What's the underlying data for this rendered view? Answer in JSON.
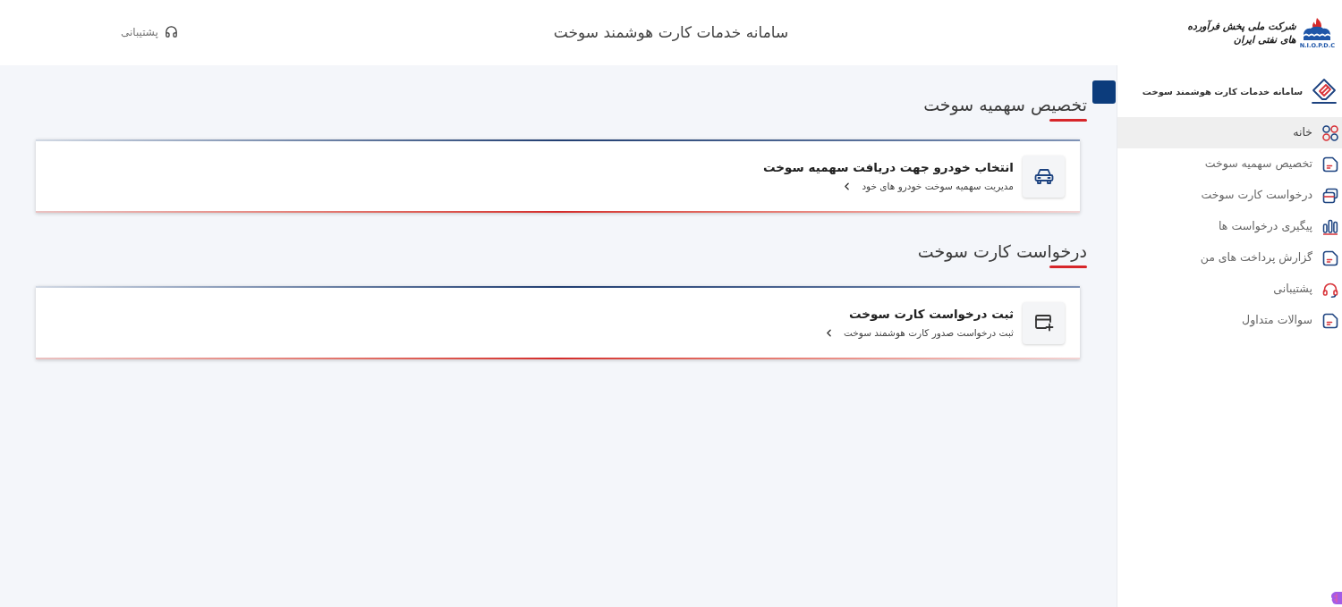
{
  "header": {
    "logo": {
      "company_name": "شرکت ملی پخش فرآورده های نفتی ایران",
      "abbreviation": "N.I.O.P.D.C"
    },
    "title": "سامانه خدمات کارت هوشمند سوخت",
    "support_link": "پشتیبانی"
  },
  "sidebar": {
    "title": "سامانه خدمات کارت هوشمند سوخت",
    "items": [
      {
        "label": "خانه",
        "selected": true
      },
      {
        "label": "تخصیص سهمیه سوخت",
        "selected": false
      },
      {
        "label": "درخواست کارت سوخت",
        "selected": false
      },
      {
        "label": "پیگیری درخواست ها",
        "selected": false
      },
      {
        "label": "گزارش پرداخت های من",
        "selected": false
      },
      {
        "label": "پشتیبانی",
        "selected": false
      },
      {
        "label": "سوالات متداول",
        "selected": false
      }
    ]
  },
  "sections": [
    {
      "title": "تخصیص سهمیه سوخت",
      "cards": [
        {
          "title": "انتخاب خودرو جهت دریافت سهمیه سوخت",
          "subtitle": "مدیریت سهمیه سوخت خودرو های خود"
        }
      ]
    },
    {
      "title": "درخواست کارت سوخت",
      "cards": [
        {
          "title": "ثبت درخواست کارت سوخت",
          "subtitle": "ثبت درخواست صدور کارت هوشمند سوخت"
        }
      ]
    }
  ]
}
